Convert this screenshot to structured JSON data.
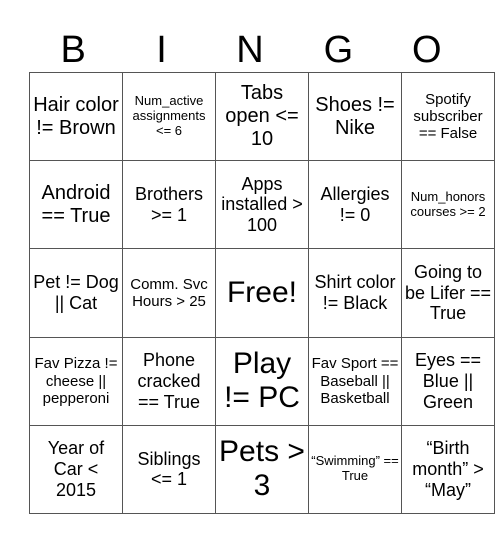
{
  "title_letters": [
    "B",
    "I",
    "N",
    "G",
    "O"
  ],
  "rows": [
    [
      {
        "text": "Hair color != Brown",
        "size": "s-l"
      },
      {
        "text": "Num_active assignments <= 6",
        "size": "s-xs"
      },
      {
        "text": "Tabs open <= 10",
        "size": "s-l"
      },
      {
        "text": "Shoes != Nike",
        "size": "s-l"
      },
      {
        "text": "Spotify subscriber == False",
        "size": "s-s"
      }
    ],
    [
      {
        "text": "Android == True",
        "size": "s-l"
      },
      {
        "text": "Brothers >= 1",
        "size": "s-m"
      },
      {
        "text": "Apps installed > 100",
        "size": "s-m"
      },
      {
        "text": "Allergies != 0",
        "size": "s-m"
      },
      {
        "text": "Num_honors courses >= 2",
        "size": "s-xs"
      }
    ],
    [
      {
        "text": "Pet != Dog || Cat",
        "size": "s-m"
      },
      {
        "text": "Comm. Svc Hours > 25",
        "size": "s-s"
      },
      {
        "text": "Free!",
        "size": "s-xl"
      },
      {
        "text": "Shirt color != Black",
        "size": "s-m"
      },
      {
        "text": "Going to be Lifer == True",
        "size": "s-m"
      }
    ],
    [
      {
        "text": "Fav Pizza != cheese || pepperoni",
        "size": "s-s"
      },
      {
        "text": "Phone cracked == True",
        "size": "s-m"
      },
      {
        "text": "Play != PC",
        "size": "s-xl"
      },
      {
        "text": "Fav Sport == Baseball || Basketball",
        "size": "s-s"
      },
      {
        "text": "Eyes == Blue || Green",
        "size": "s-m"
      }
    ],
    [
      {
        "text": "Year of Car < 2015",
        "size": "s-m"
      },
      {
        "text": "Siblings <= 1",
        "size": "s-m"
      },
      {
        "text": "Pets > 3",
        "size": "s-xl"
      },
      {
        "text": "“Swimming” == True",
        "size": "s-xs"
      },
      {
        "text": "“Birth month” > “May”",
        "size": "s-m"
      }
    ]
  ]
}
